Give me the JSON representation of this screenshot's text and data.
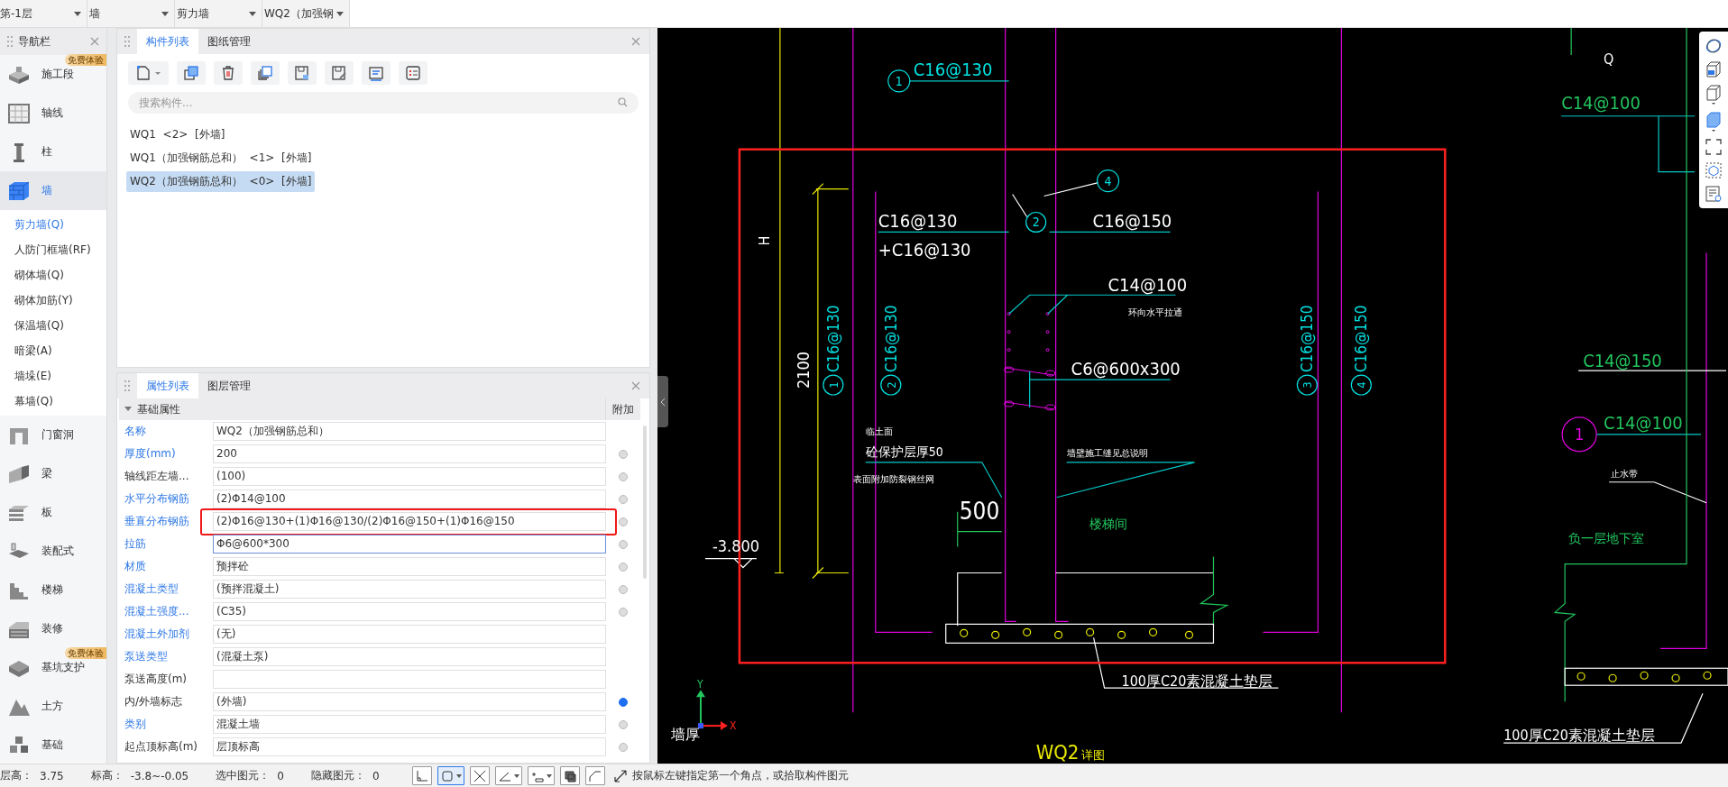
{
  "top_bar": {
    "dropdowns": [
      "第-1层",
      "墙",
      "剪力墙",
      "WQ2（加强钢"
    ]
  },
  "nav": {
    "title": "导航栏",
    "items": [
      {
        "label": "施工段",
        "selected": false,
        "badge": "免费体验"
      },
      {
        "label": "轴线",
        "selected": false
      },
      {
        "label": "柱",
        "selected": false
      },
      {
        "label": "墙",
        "selected": true,
        "children": [
          {
            "label": "剪力墙(Q)",
            "selected": true
          },
          {
            "label": "人防门框墙(RF)",
            "selected": false
          },
          {
            "label": "砌体墙(Q)",
            "selected": false
          },
          {
            "label": "砌体加筋(Y)",
            "selected": false
          },
          {
            "label": "保温墙(Q)",
            "selected": false
          },
          {
            "label": "暗梁(A)",
            "selected": false
          },
          {
            "label": "墙垛(E)",
            "selected": false
          },
          {
            "label": "幕墙(Q)",
            "selected": false
          }
        ]
      },
      {
        "label": "门窗洞",
        "selected": false
      },
      {
        "label": "梁",
        "selected": false
      },
      {
        "label": "板",
        "selected": false
      },
      {
        "label": "装配式",
        "selected": false
      },
      {
        "label": "楼梯",
        "selected": false
      },
      {
        "label": "装修",
        "selected": false
      },
      {
        "label": "基坑支护",
        "selected": false,
        "badge": "免费体验"
      },
      {
        "label": "土方",
        "selected": false
      },
      {
        "label": "基础",
        "selected": false
      }
    ]
  },
  "component_panel": {
    "tabs": [
      {
        "label": "构件列表",
        "selected": true
      },
      {
        "label": "图纸管理",
        "selected": false
      }
    ],
    "search": {
      "placeholder": "搜索构件..."
    },
    "items": [
      {
        "label": "WQ1  <2>  [外墙]",
        "selected": false
      },
      {
        "label": "WQ1（加强钢筋总和）  <1>  [外墙]",
        "selected": false
      },
      {
        "label": "WQ2（加强钢筋总和）  <0>  [外墙]",
        "selected": true
      }
    ]
  },
  "properties_panel": {
    "tabs": [
      {
        "label": "属性列表",
        "selected": true
      },
      {
        "label": "图层管理",
        "selected": false
      }
    ],
    "group": {
      "label": "基础属性",
      "expanded": true
    },
    "extra_header": "附加",
    "rows": [
      {
        "name": "名称",
        "public": true,
        "value": "WQ2（加强钢筋总和）",
        "focused": false,
        "annotated": false
      },
      {
        "name": "厚度(mm)",
        "public": true,
        "value": "200",
        "checked": false,
        "focused": false,
        "annotated": false
      },
      {
        "name": "轴线距左墙...",
        "public": false,
        "value": "(100)",
        "checked": false,
        "focused": false,
        "annotated": false
      },
      {
        "name": "水平分布钢筋",
        "public": true,
        "value": "(2)Φ14@100",
        "checked": false,
        "focused": false,
        "annotated": false
      },
      {
        "name": "垂直分布钢筋",
        "public": true,
        "value": "(2)Φ16@130+(1)Φ16@130/(2)Φ16@150+(1)Φ16@150",
        "checked": false,
        "focused": false,
        "annotated": true
      },
      {
        "name": "拉筋",
        "public": true,
        "value": "Φ6@600*300",
        "checked": false,
        "focused": true,
        "annotated": false
      },
      {
        "name": "材质",
        "public": true,
        "value": "预拌砼",
        "checked": false,
        "focused": false,
        "annotated": false
      },
      {
        "name": "混凝土类型",
        "public": true,
        "value": "(预拌混凝土)",
        "checked": false,
        "focused": false,
        "annotated": false
      },
      {
        "name": "混凝土强度...",
        "public": true,
        "value": "(C35)",
        "checked": false,
        "focused": false,
        "annotated": false
      },
      {
        "name": "混凝土外加剂",
        "public": true,
        "value": "(无)",
        "focused": false,
        "annotated": false
      },
      {
        "name": "泵送类型",
        "public": true,
        "value": "(混凝土泵)",
        "focused": false,
        "annotated": false
      },
      {
        "name": "泵送高度(m)",
        "public": false,
        "focused": false,
        "annotated": false
      },
      {
        "name": "内/外墙标志",
        "public": false,
        "value": "(外墙)",
        "checked": true,
        "focused": false,
        "annotated": false
      },
      {
        "name": "类别",
        "public": true,
        "value": "混凝土墙",
        "checked": false,
        "focused": false,
        "annotated": false
      },
      {
        "name": "起点顶标高(m)",
        "public": false,
        "value": "层顶标高",
        "checked": false,
        "focused": false,
        "annotated": false
      }
    ]
  },
  "cad": {
    "labels": [
      {
        "kind": "circle",
        "text": "1"
      },
      {
        "kind": "text",
        "text": "C16@130"
      },
      {
        "kind": "text",
        "text": "H"
      },
      {
        "kind": "text",
        "text": "2100"
      },
      {
        "kind": "circle",
        "text": "4"
      },
      {
        "kind": "text",
        "text": "C16@130"
      },
      {
        "kind": "circle",
        "text": "2"
      },
      {
        "kind": "text",
        "text": "+C16@130"
      },
      {
        "kind": "text",
        "text": "C16@150"
      },
      {
        "kind": "text",
        "text": "C14@100"
      },
      {
        "kind": "text",
        "text": "环向水平拉通"
      },
      {
        "kind": "text",
        "text": "C6@600x300"
      },
      {
        "kind": "vlabel",
        "num": "1",
        "text": "C16@130"
      },
      {
        "kind": "vlabel",
        "num": "2",
        "text": "C16@130"
      },
      {
        "kind": "vlabel",
        "num": "3",
        "text": "C16@150"
      },
      {
        "kind": "vlabel",
        "num": "4",
        "text": "C16@150"
      },
      {
        "kind": "text",
        "text": "临土面"
      },
      {
        "kind": "text",
        "text": "砼保护层厚50"
      },
      {
        "kind": "text",
        "text": "表面附加防裂钢丝网"
      },
      {
        "kind": "text",
        "text": "墙壁施工缝见总说明"
      },
      {
        "kind": "text",
        "text": "500"
      },
      {
        "kind": "text",
        "text": "楼梯间"
      },
      {
        "kind": "text",
        "text": "-3.800"
      },
      {
        "kind": "text",
        "text": "100厚C20素混凝土垫层"
      },
      {
        "kind": "text",
        "text": "Q"
      },
      {
        "kind": "text",
        "text": "C14@100"
      },
      {
        "kind": "text",
        "text": "C14@150"
      },
      {
        "kind": "circle",
        "text": "1"
      },
      {
        "kind": "text",
        "text": "C14@100"
      },
      {
        "kind": "text",
        "text": "止水带"
      },
      {
        "kind": "text",
        "text": "负一层地下室"
      },
      {
        "kind": "text",
        "text": "墙厚"
      },
      {
        "kind": "text",
        "text": "100厚C20素混凝土垫层"
      },
      {
        "kind": "text",
        "text": "WQ2"
      },
      {
        "kind": "text",
        "text": "详图"
      },
      {
        "kind": "text",
        "text": "Y"
      },
      {
        "kind": "text",
        "text": "X"
      }
    ]
  },
  "status_bar": {
    "fields": [
      {
        "label": "层高：",
        "value": "3.75"
      },
      {
        "label": "标高：",
        "value": "-3.8~-0.05"
      },
      {
        "label": "选中图元：",
        "value": "0"
      },
      {
        "label": "隐藏图元：",
        "value": "0"
      }
    ],
    "tools": [
      {
        "selected": false,
        "dropdown": false
      },
      {
        "selected": true,
        "dropdown": true
      },
      {
        "selected": false,
        "dropdown": false
      },
      {
        "selected": false,
        "dropdown": true
      },
      {
        "selected": false,
        "dropdown": true
      },
      {
        "selected": false,
        "dropdown": false
      },
      {
        "selected": false,
        "dropdown": false
      }
    ],
    "hint": "按鼠标左键指定第一个角点，或拾取构件图元"
  }
}
